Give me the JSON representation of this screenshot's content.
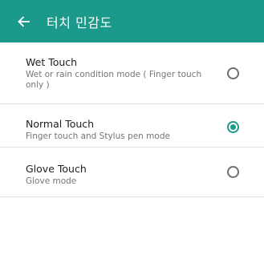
{
  "header": {
    "title": "터치 민감도"
  },
  "options": [
    {
      "title": "Wet Touch",
      "description": "Wet or rain condition mode ( Finger touch only )",
      "selected": false
    },
    {
      "title": "Normal Touch",
      "description": "Finger touch and Stylus pen mode",
      "selected": true
    },
    {
      "title": "Glove Touch",
      "description": "Glove mode",
      "selected": false
    }
  ],
  "colors": {
    "accent": "#1b9a8b",
    "app_bar": "#1b9a8b",
    "primary_text": "#212121",
    "secondary_text": "#757575",
    "divider": "#e2e2e2"
  },
  "icons": {
    "back": "arrow-left-icon"
  }
}
